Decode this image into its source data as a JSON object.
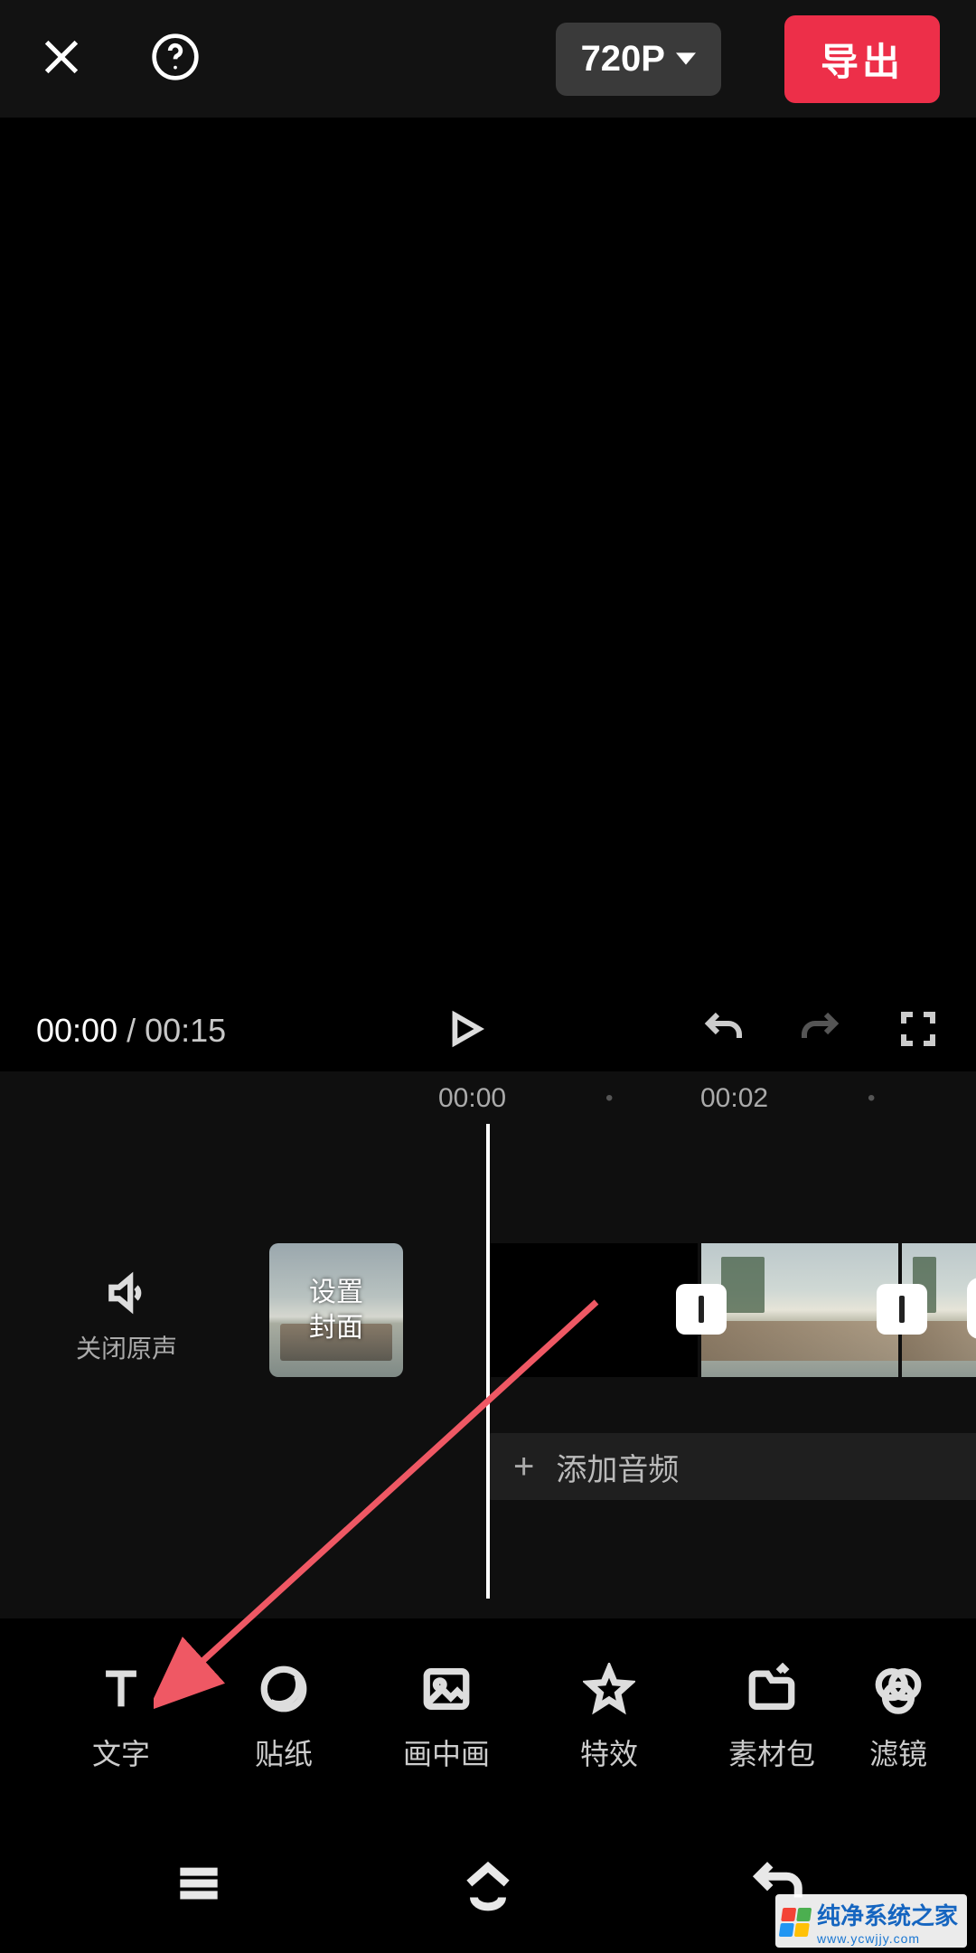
{
  "header": {
    "resolution": "720P",
    "export": "导出"
  },
  "playbar": {
    "current_time": "00:00",
    "separator": " / ",
    "total_time": "00:15"
  },
  "ruler": {
    "t0": "00:00",
    "t2": "00:02"
  },
  "mute": {
    "label": "关闭原声"
  },
  "cover": {
    "label": "设置\n封面"
  },
  "audio": {
    "add_label": "添加音频"
  },
  "tools": [
    {
      "key": "text",
      "label": "文字"
    },
    {
      "key": "sticker",
      "label": "贴纸"
    },
    {
      "key": "pip",
      "label": "画中画"
    },
    {
      "key": "effect",
      "label": "特效"
    },
    {
      "key": "pack",
      "label": "素材包"
    },
    {
      "key": "filter",
      "label": "滤镜"
    }
  ],
  "watermark": {
    "brand": "纯净系统之家",
    "url": "www.ycwjjy.com"
  }
}
